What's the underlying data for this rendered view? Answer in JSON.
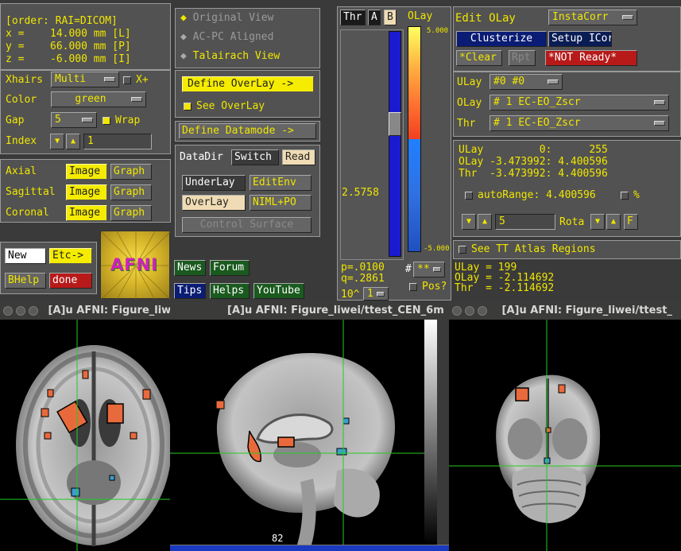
{
  "coords": {
    "order": "[order: RAI=DICOM]",
    "x_label": "x =",
    "x_value": "14.000 mm [L]",
    "y_label": "y =",
    "y_value": "66.000 mm [P]",
    "z_label": "z =",
    "z_value": "-6.000 mm [I]"
  },
  "controls": {
    "xhairs_label": "Xhairs",
    "xhairs_value": "Multi",
    "xplus_label": "X+",
    "color_label": "Color",
    "color_value": "green",
    "gap_label": "Gap",
    "gap_value": "5",
    "wrap_label": "Wrap",
    "index_label": "Index",
    "index_value": "1"
  },
  "views": {
    "rows": [
      {
        "label": "Axial",
        "image": "Image",
        "graph": "Graph"
      },
      {
        "label": "Sagittal",
        "image": "Image",
        "graph": "Graph"
      },
      {
        "label": "Coronal",
        "image": "Image",
        "graph": "Graph"
      }
    ]
  },
  "bottom_left": {
    "new": "New",
    "etc": "Etc->",
    "bhelp": "BHelp",
    "done": "done"
  },
  "logo": {
    "text": "AFNI"
  },
  "links": {
    "news": "News",
    "forum": "Forum",
    "tips": "Tips",
    "helps": "Helps",
    "youtube": "YouTube"
  },
  "view_mode": {
    "original": "Original View",
    "acpc": "AC-PC Aligned",
    "talairach": "Talairach View"
  },
  "middle": {
    "define_overlay": "Define OverLay ->",
    "see_overlay": "See OverLay",
    "define_datamode": "Define Datamode ->",
    "datadir": "DataDir",
    "switch": "Switch",
    "read": "Read",
    "underlay": "UnderLay",
    "editenv": "EditEnv",
    "overlay": "OverLay",
    "nimlpo": "NIML+PO",
    "control_surface": "Control Surface"
  },
  "thr": {
    "label": "Thr",
    "a": "A",
    "b": "B",
    "value": "2.5758",
    "p": "p=.0100",
    "q": "q=.2861",
    "exp_label": "10^",
    "exp_value": "1",
    "slider_level": 0.6
  },
  "olay": {
    "label": "OLay",
    "top": "5.000",
    "bottom": "-5.000",
    "star_menu": "**",
    "pos_label": "Pos?"
  },
  "edit": {
    "title": "Edit OLay",
    "instacorr": "InstaCorr",
    "clusterize": "Clusterize",
    "setup_icorr": "Setup ICorr",
    "clear": "*Clear",
    "rpt": "Rpt",
    "not_ready": "*NOT Ready*",
    "ulay_label": "ULay",
    "ulay_value": "#0 #0",
    "olay_label": "OLay",
    "olay_value": "# 1 EC-EO_Zscr",
    "thr_label": "Thr",
    "thr_value": "# 1 EC-EO_Zscr"
  },
  "ranges": {
    "line1": "ULay         0:      255",
    "line2": "OLay -3.473992: 4.400596",
    "line3": "Thr  -3.473992: 4.400596",
    "autorange": "autoRange: 4.400596",
    "percent": "%",
    "rota_value": "5",
    "rota_label": "Rota",
    "f": "F"
  },
  "atlas": {
    "label": "See TT Atlas Regions"
  },
  "values": {
    "ulay": "ULay = 199",
    "olay": "OLay = -2.114692",
    "thr": "Thr  = -2.114692"
  },
  "windows": {
    "w1_title": "[A]u AFNI: Figure_liw",
    "w2_title": "[A]u AFNI: Figure_liwei/ttest_CEN_6m",
    "w3_title": "[A]u AFNI: Figure_liwei/ttest_",
    "slider_value": "82"
  },
  "colors": {
    "yellow": "#f0e600",
    "crosshair": "#22cc22",
    "bg": "#525252"
  }
}
